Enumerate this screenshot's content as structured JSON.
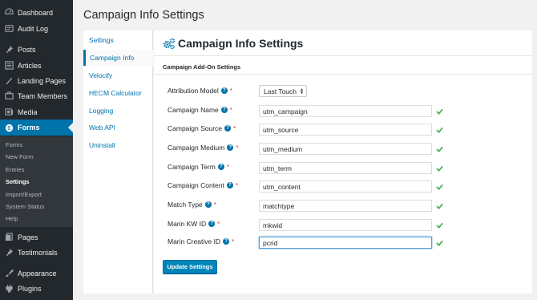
{
  "sidebar": {
    "items": [
      {
        "label": "Dashboard",
        "icon": "dashboard-icon"
      },
      {
        "label": "Audit Log",
        "icon": "audit-log-icon"
      },
      {
        "label": "Posts",
        "icon": "pin-icon"
      },
      {
        "label": "Articles",
        "icon": "articles-icon"
      },
      {
        "label": "Landing Pages",
        "icon": "landing-pages-icon"
      },
      {
        "label": "Team Members",
        "icon": "team-members-icon"
      },
      {
        "label": "Media",
        "icon": "media-icon"
      },
      {
        "label": "Forms",
        "icon": "forms-icon"
      },
      {
        "label": "Pages",
        "icon": "pages-icon"
      },
      {
        "label": "Testimonials",
        "icon": "pin-icon"
      },
      {
        "label": "Appearance",
        "icon": "appearance-icon"
      },
      {
        "label": "Plugins",
        "icon": "plugins-icon"
      }
    ],
    "submenu": [
      "Forms",
      "New Form",
      "Entries",
      "Settings",
      "Import/Export",
      "System Status",
      "Help"
    ]
  },
  "page_title": "Campaign Info Settings",
  "settings_nav": [
    "Settings",
    "Campaign Info",
    "Velocify",
    "HECM Calculator",
    "Logging",
    "Web API",
    "Uninstall"
  ],
  "content": {
    "title": "Campaign Info Settings",
    "section_title": "Campaign Add-On Settings",
    "attribution": {
      "label": "Attribution Model",
      "value": "Last Touch"
    },
    "fields": [
      {
        "label": "Campaign Name",
        "value": "utm_campaign"
      },
      {
        "label": "Campaign Source",
        "value": "utm_source"
      },
      {
        "label": "Campaign Medium",
        "value": "utm_medium"
      },
      {
        "label": "Campaign Term",
        "value": "utm_term"
      },
      {
        "label": "Campaign Content",
        "value": "utm_content"
      },
      {
        "label": "Match Type",
        "value": "matchtype"
      },
      {
        "label": "Marin KW ID",
        "value": "mkwid"
      },
      {
        "label": "Marin Creative ID",
        "value": "pcrid"
      }
    ],
    "help_glyph": "?",
    "required_mark": "*",
    "update_button": "Update Settings"
  },
  "colors": {
    "accent": "#0073aa",
    "sidebar_bg": "#23282d",
    "submenu_bg": "#32373c",
    "check": "#46b450",
    "required": "#d63638"
  }
}
